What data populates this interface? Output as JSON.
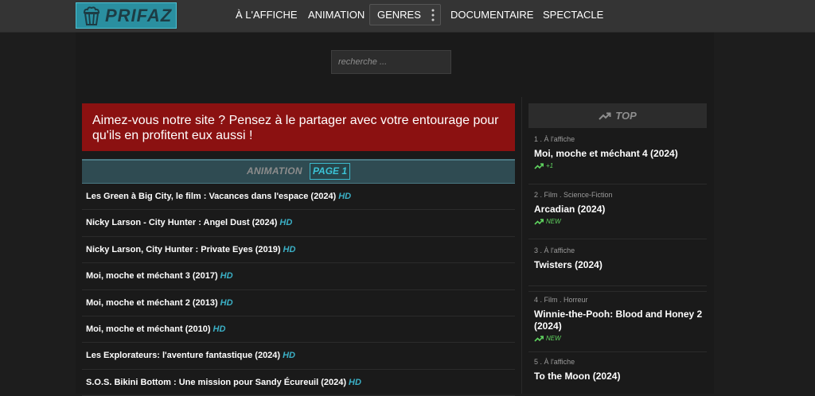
{
  "header": {
    "logo_text": "PRIFAZ",
    "nav": [
      {
        "label": "À L'AFFICHE"
      },
      {
        "label": "ANIMATION"
      },
      {
        "label": "GENRES"
      },
      {
        "label": "DOCUMENTAIRE"
      },
      {
        "label": "SPECTACLE"
      }
    ]
  },
  "search": {
    "placeholder": "recherche ..."
  },
  "share_message": "Aimez-vous notre site ? Pensez à le partager avec votre entourage pour qu'ils en profitent eux aussi !",
  "section": {
    "title": "ANIMATION",
    "page_badge": "PAGE 1"
  },
  "list": [
    {
      "title": "Les Green à Big City, le film : Vacances dans l'espace (2024)",
      "quality": "HD"
    },
    {
      "title": "Nicky Larson - City Hunter : Angel Dust (2024)",
      "quality": "HD"
    },
    {
      "title": "Nicky Larson, City Hunter : Private Eyes (2019)",
      "quality": "HD"
    },
    {
      "title": "Moi, moche et méchant 3 (2017)",
      "quality": "HD"
    },
    {
      "title": "Moi, moche et méchant 2 (2013)",
      "quality": "HD"
    },
    {
      "title": "Moi, moche et méchant (2010)",
      "quality": "HD"
    },
    {
      "title": "Les Explorateurs: l'aventure fantastique (2024)",
      "quality": "HD"
    },
    {
      "title": "S.O.S. Bikini Bottom : Une mission pour Sandy Écureuil (2024)",
      "quality": "HD"
    }
  ],
  "sidebar": {
    "title": "TOP",
    "items": [
      {
        "meta": "1 . À l'affiche",
        "title": "Moi, moche et méchant 4 (2024)",
        "trend": "+1"
      },
      {
        "meta": "2 . Film . Science-Fiction",
        "title": "Arcadian (2024)",
        "trend": "NEW"
      },
      {
        "meta": "3 . À l'affiche",
        "title": "Twisters (2024)",
        "trend": ""
      },
      {
        "meta": "4 . Film . Horreur",
        "title": "Winnie-the-Pooh: Blood and Honey 2 (2024)",
        "trend": "NEW"
      },
      {
        "meta": "5 . À l'affiche",
        "title": "To the Moon (2024)",
        "trend": ""
      }
    ]
  },
  "colors": {
    "accent": "#3bb0c6",
    "share_bg": "#8b1111",
    "trend": "#5fd35f"
  }
}
